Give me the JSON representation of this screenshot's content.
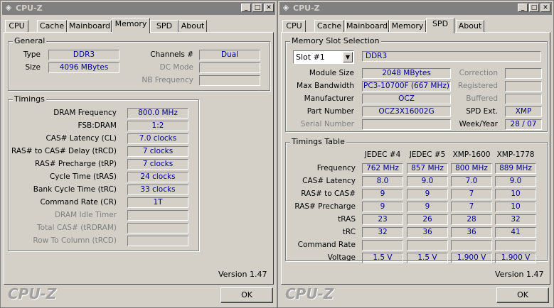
{
  "left_window": {
    "title": "CPU-Z",
    "tabs": [
      "CPU",
      "Cache",
      "Mainboard",
      "Memory",
      "SPD",
      "About"
    ],
    "active_tab": "Memory",
    "general": {
      "group_label": "General",
      "type_label": "Type",
      "type_value": "DDR3",
      "size_label": "Size",
      "size_value": "4096 MBytes",
      "channels_label": "Channels #",
      "channels_value": "Dual",
      "dc_mode_label": "DC Mode",
      "dc_mode_value": "",
      "nb_freq_label": "NB Frequency",
      "nb_freq_value": ""
    },
    "timings": {
      "group_label": "Timings",
      "rows": [
        {
          "label": "DRAM Frequency",
          "value": "800.0 MHz",
          "enabled": true
        },
        {
          "label": "FSB:DRAM",
          "value": "1:2",
          "enabled": true
        },
        {
          "label": "CAS# Latency (CL)",
          "value": "7.0 clocks",
          "enabled": true
        },
        {
          "label": "RAS# to CAS# Delay (tRCD)",
          "value": "7 clocks",
          "enabled": true
        },
        {
          "label": "RAS# Precharge (tRP)",
          "value": "7 clocks",
          "enabled": true
        },
        {
          "label": "Cycle Time (tRAS)",
          "value": "24 clocks",
          "enabled": true
        },
        {
          "label": "Bank Cycle Time (tRC)",
          "value": "33 clocks",
          "enabled": true
        },
        {
          "label": "Command Rate (CR)",
          "value": "1T",
          "enabled": true
        },
        {
          "label": "DRAM Idle Timer",
          "value": "",
          "enabled": false
        },
        {
          "label": "Total CAS# (tRDRAM)",
          "value": "",
          "enabled": false
        },
        {
          "label": "Row To Column (tRCD)",
          "value": "",
          "enabled": false
        }
      ]
    },
    "version": "Version 1.47",
    "logo": "CPU-Z",
    "ok_label": "OK"
  },
  "right_window": {
    "title": "CPU-Z",
    "tabs": [
      "CPU",
      "Cache",
      "Mainboard",
      "Memory",
      "SPD",
      "About"
    ],
    "active_tab": "SPD",
    "slot_group_label": "Memory Slot Selection",
    "slot_select": "Slot #1",
    "slot_type": "DDR3",
    "module_size_label": "Module Size",
    "module_size": "2048 MBytes",
    "max_bw_label": "Max Bandwidth",
    "max_bw": "PC3-10700F (667 MHz)",
    "manufacturer_label": "Manufacturer",
    "manufacturer": "OCZ",
    "part_label": "Part Number",
    "part": "OCZ3X16002G",
    "serial_label": "Serial Number",
    "serial": "",
    "correction_label": "Correction",
    "correction": "",
    "registered_label": "Registered",
    "registered": "",
    "buffered_label": "Buffered",
    "buffered": "",
    "spd_ext_label": "SPD Ext.",
    "spd_ext": "XMP",
    "week_year_label": "Week/Year",
    "week_year": "28 / 07",
    "timings_table": {
      "group_label": "Timings Table",
      "columns": [
        "JEDEC #4",
        "JEDEC #5",
        "XMP-1600",
        "XMP-1778"
      ],
      "rows": [
        {
          "label": "Frequency",
          "values": [
            "762 MHz",
            "857 MHz",
            "800 MHz",
            "889 MHz"
          ]
        },
        {
          "label": "CAS# Latency",
          "values": [
            "8.0",
            "9.0",
            "7.0",
            "9.0"
          ]
        },
        {
          "label": "RAS# to CAS#",
          "values": [
            "9",
            "9",
            "7",
            "10"
          ]
        },
        {
          "label": "RAS# Precharge",
          "values": [
            "9",
            "9",
            "7",
            "10"
          ]
        },
        {
          "label": "tRAS",
          "values": [
            "23",
            "26",
            "28",
            "32"
          ]
        },
        {
          "label": "tRC",
          "values": [
            "32",
            "36",
            "36",
            "41"
          ]
        },
        {
          "label": "Command Rate",
          "values": [
            "",
            "",
            "",
            ""
          ]
        },
        {
          "label": "Voltage",
          "values": [
            "1.5 V",
            "1.5 V",
            "1.900 V",
            "1.900 V"
          ]
        }
      ]
    },
    "version": "Version 1.47",
    "logo": "CPU-Z",
    "ok_label": "OK"
  }
}
